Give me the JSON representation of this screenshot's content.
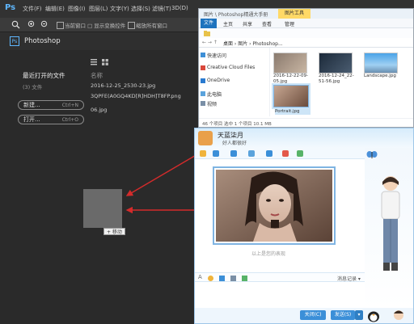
{
  "colors": {
    "ps_bg": "#2b2b2b",
    "accent_red": "#d42b2b",
    "qq_blue": "#3b8fd8",
    "explorer_tools_tab": "#ffd966"
  },
  "photoshop": {
    "logo": "Ps",
    "menus": [
      "文件(F)",
      "编辑(E)",
      "图像(I)",
      "图层(L)",
      "文字(Y)",
      "选择(S)",
      "滤镜(T)",
      "3D(D)"
    ],
    "options": {
      "show_transform": "当前窗口 □ 显示变换控件",
      "align_edges": "缩放所有窗口"
    },
    "tab_title": "Photoshop",
    "start": {
      "recent_heading": "最近打开的文件",
      "recent_count": "(3) 文件",
      "name_col": "名称",
      "files": [
        "2016-12-25_2530-23.jpg",
        "3QPFE(A0GQ4KD[R]HDH]T8FP.png",
        "06.jpg"
      ],
      "new_button": "新建...",
      "new_shortcut": "Ctrl+N",
      "open_button": "打开...",
      "open_shortcut": "Ctrl+O"
    },
    "drag_label": "+ 移动"
  },
  "explorer": {
    "title": "图片 \\ Photoshop精通大手册",
    "tools_tab": "图片工具",
    "ribbon_tabs": [
      "文件",
      "主页",
      "共享",
      "查看",
      "管理"
    ],
    "address": "桌面 › 图片 › Photoshop...",
    "nav_items": [
      "快速访问",
      "Creative Cloud Files",
      "OneDrive",
      "此电脑",
      "视频"
    ],
    "files": [
      {
        "name": "2016-12-22-09-05.jpg"
      },
      {
        "name": "2016-12-24_22-51-56.jpg"
      },
      {
        "name": "Landscape.jpg"
      },
      {
        "name": "Portrait.jpg"
      }
    ],
    "status": "46 个项目    选中 1 个项目  10.1 MB"
  },
  "qq": {
    "name": "天蓝柒月",
    "subtitle": "好人都很好",
    "caption": "以上是您的表现",
    "record_label": "消息记录 ▾",
    "close_button": "关闭(C)",
    "send_button": "发送(S)"
  }
}
